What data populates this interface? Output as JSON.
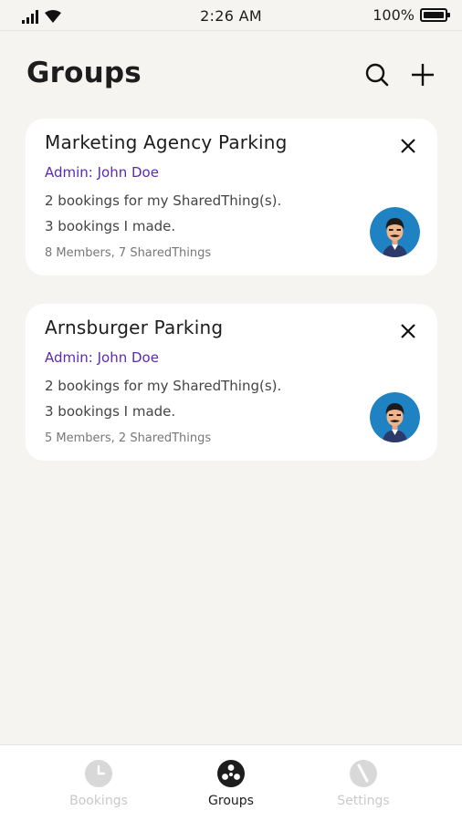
{
  "status_bar": {
    "time": "2:26 AM",
    "battery_text": "100%",
    "battery_level": 1.0,
    "icons": [
      "signal-icon",
      "wifi-icon",
      "battery-icon"
    ]
  },
  "header": {
    "title": "Groups",
    "icons": [
      "search-icon",
      "plus-icon"
    ]
  },
  "groups": [
    {
      "title": "Marketing Agency Parking",
      "admin": "Admin: John Doe",
      "bookings_for_mine": "2 bookings for my SharedThing(s).",
      "bookings_made": "3 bookings I made.",
      "meta": "8 Members, 7 SharedThings"
    },
    {
      "title": "Arnsburger Parking",
      "admin": "Admin: John Doe",
      "bookings_for_mine": "2 bookings for my SharedThing(s).",
      "bookings_made": "3 bookings I made.",
      "meta": "5 Members, 2 SharedThings"
    }
  ],
  "bottom_nav": {
    "items": [
      {
        "label": "Bookings",
        "icon": "clock-icon",
        "active": false
      },
      {
        "label": "Groups",
        "icon": "groups-icon",
        "active": true
      },
      {
        "label": "Settings",
        "icon": "settings-icon",
        "active": false
      }
    ]
  },
  "colors": {
    "background": "#f5f4f1",
    "card": "#ffffff",
    "admin_accent": "#5d28b4",
    "avatar_bg": "#1e82c3",
    "nav_inactive": "#c9c9c9"
  }
}
